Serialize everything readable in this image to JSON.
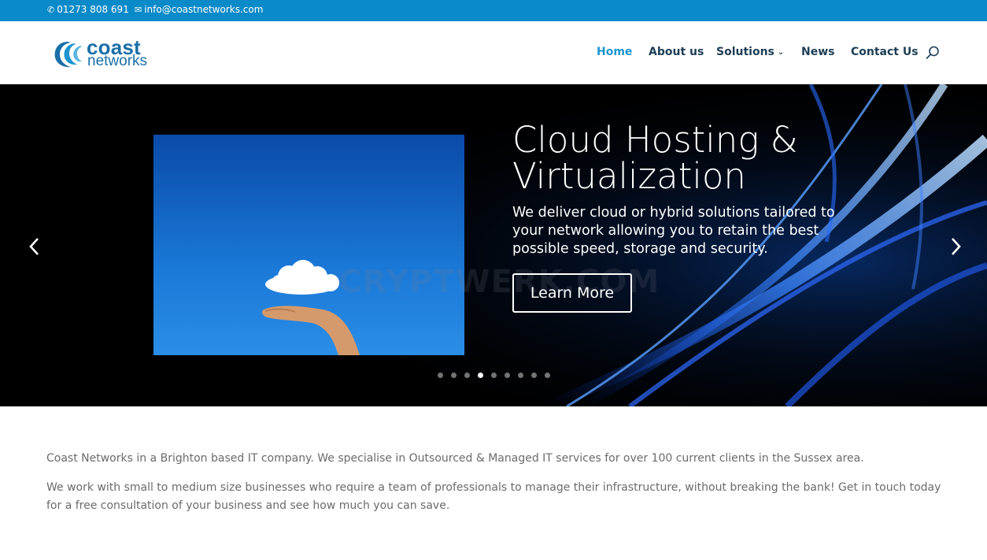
{
  "topbar": {
    "phone": "01273 808 691",
    "phone_icon": "phone-icon",
    "email": "info@coastnetworks.com",
    "email_icon": "envelope-icon",
    "background": "#0a8ac8"
  },
  "header": {
    "logo": {
      "word1": "coast",
      "word2": "networks",
      "color": "#1a6fa8"
    },
    "nav": {
      "home": "Home",
      "about": "About us",
      "solutions": "Solutions",
      "news": "News",
      "contact": "Contact Us"
    },
    "active_color": "#1c95d0",
    "search_icon": "search-icon"
  },
  "hero": {
    "title": "Cloud Hosting & Virtualization",
    "description": "We deliver cloud or hybrid solutions tailored to your network allowing you to retain the best possible speed, storage and security.",
    "button": "Learn More",
    "watermark": "CRYPTWERK.COM",
    "prev_icon": "chevron-left-icon",
    "next_icon": "chevron-right-icon",
    "slide_count": 9,
    "active_slide": 4
  },
  "content": {
    "paragraph1": "Coast Networks in a Brighton based IT company. We specialise in Outsourced & Managed IT services for over 100 current clients in the Sussex area.",
    "paragraph2": "We work with small to medium size businesses who require a team of professionals to manage their infrastructure, without breaking the bank! Get in touch today for a free consultation of your business and see how much you can save."
  }
}
